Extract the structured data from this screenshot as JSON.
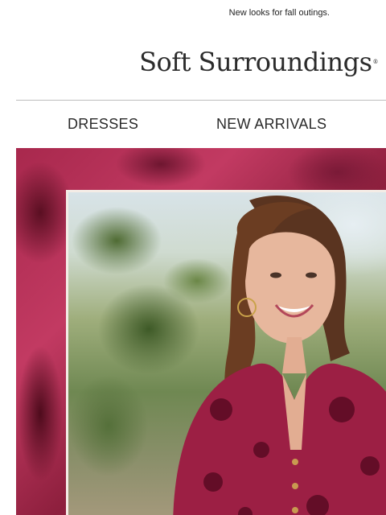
{
  "preheader": {
    "text": "New looks for fall outings."
  },
  "brand": {
    "name": "Soft Surroundings",
    "trademark": "®"
  },
  "nav": {
    "items": [
      {
        "label": "DRESSES"
      },
      {
        "label": "NEW ARRIVALS"
      }
    ]
  },
  "hero": {
    "image_description_icon": "model-photo",
    "colors": {
      "print": "#a8284d",
      "frame": "#f4ece6"
    }
  }
}
